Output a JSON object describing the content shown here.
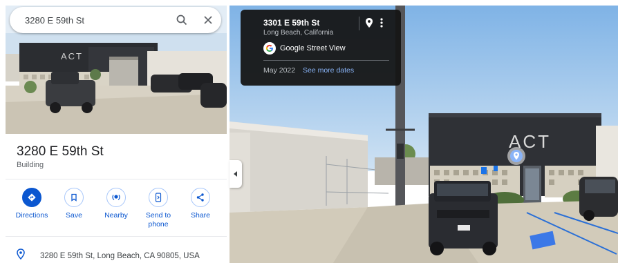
{
  "search": {
    "value": "3280 E 59th St"
  },
  "place": {
    "title": "3280 E 59th St",
    "type": "Building",
    "address": "3280 E 59th St, Long Beach, CA 90805, USA"
  },
  "actions": [
    {
      "label": "Directions",
      "icon": "directions-icon"
    },
    {
      "label": "Save",
      "icon": "bookmark-icon"
    },
    {
      "label": "Nearby",
      "icon": "nearby-icon"
    },
    {
      "label": "Send to phone",
      "icon": "send-to-phone-icon"
    },
    {
      "label": "Share",
      "icon": "share-icon"
    }
  ],
  "street_view": {
    "address": "3301 E 59th St",
    "city": "Long Beach, California",
    "provider": "Google Street View",
    "date": "May 2022",
    "more_dates": "See more dates"
  },
  "signage": {
    "building_sign": "ACT"
  },
  "colors": {
    "accent": "#0b57d0",
    "link": "#8ab4f8",
    "card_bg": "#141414"
  }
}
